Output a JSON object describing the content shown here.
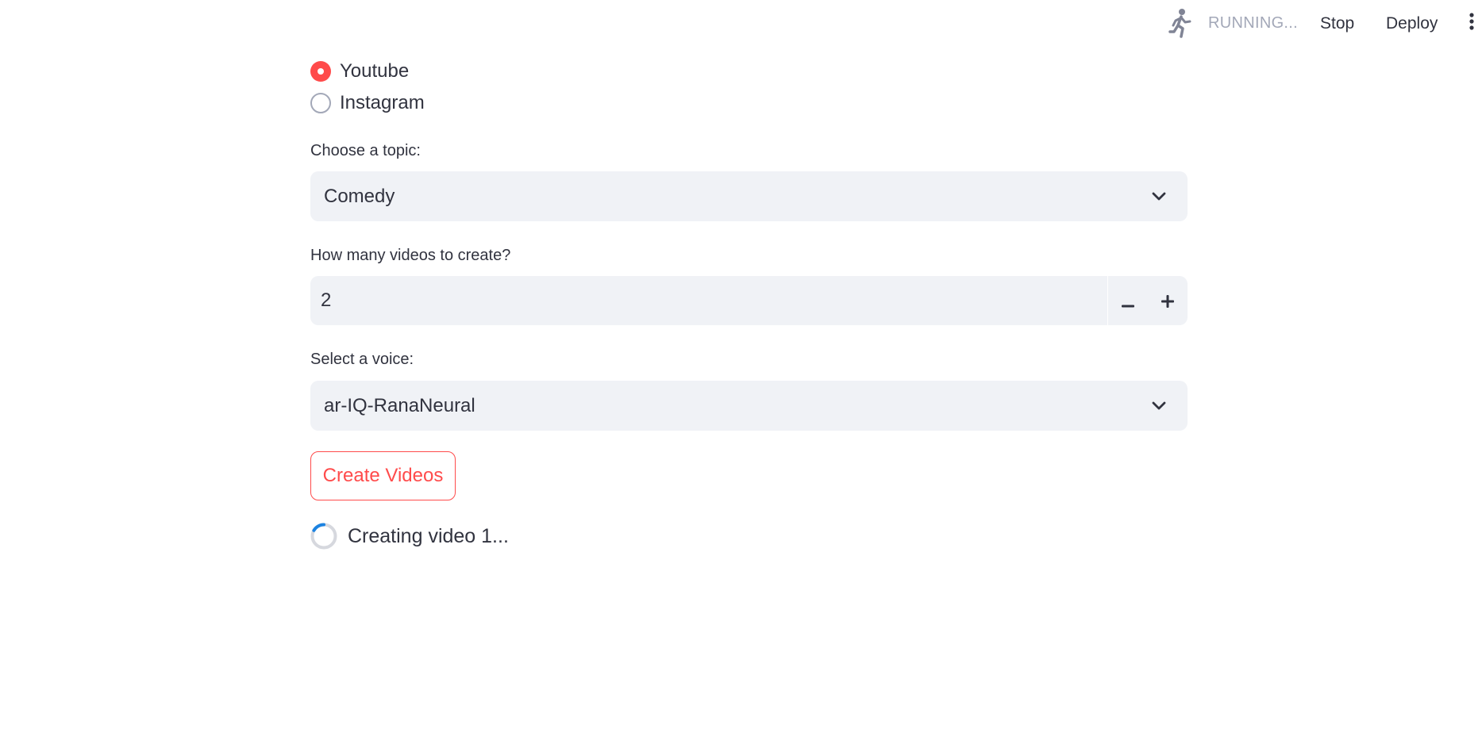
{
  "header": {
    "status_icon": "running-person-icon",
    "status_text": "RUNNING...",
    "stop_label": "Stop",
    "deploy_label": "Deploy",
    "menu_icon": "kebab-menu-icon"
  },
  "platform": {
    "options": [
      {
        "label": "Youtube",
        "selected": true
      },
      {
        "label": "Instagram",
        "selected": false
      }
    ]
  },
  "topic": {
    "label": "Choose a topic:",
    "value": "Comedy"
  },
  "video_count": {
    "label": "How many videos to create?",
    "value": "2",
    "decrement_icon": "minus-icon",
    "increment_icon": "plus-icon"
  },
  "voice": {
    "label": "Select a voice:",
    "value": "ar-IQ-RanaNeural"
  },
  "create_button": {
    "label": "Create Videos"
  },
  "progress": {
    "text": "Creating video 1..."
  },
  "colors": {
    "accent": "#ff4b4b",
    "input_bg": "#f0f2f6",
    "text": "#31333f",
    "muted": "#a3a8b8",
    "spinner": "#1c83e1"
  }
}
